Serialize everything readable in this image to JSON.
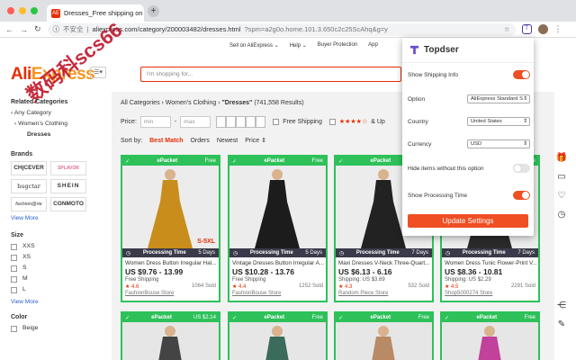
{
  "browser": {
    "tab_title": "Dresses_Free shipping on Dres",
    "tab_favicon": "AE",
    "new_tab": "+",
    "nav": {
      "back": "←",
      "forward": "→",
      "reload": "↻"
    },
    "security": "不安全",
    "url_main": "aliexpress.com/category/200003482/dresses.html",
    "url_query": "?spm=a2g0o.home.101.3.650c2c25ScAhq&g=y"
  },
  "topnav": [
    "Sell on AliExpress ⌄",
    "Help ⌄",
    "Buyer Protection",
    "App"
  ],
  "logo": {
    "ali": "Ali",
    "express": "Express"
  },
  "watermark": "数码科scs66",
  "search_placeholder": "I'm shopping for...",
  "sidebar": {
    "related_title": "Related Categories",
    "categories": [
      "‹  Any Category",
      "‹  Women's Clothing",
      "Dresses"
    ],
    "brands_title": "Brands",
    "brands": [
      "CH|CEVER",
      "SPLAVOR",
      "hugctar",
      "SHEIN",
      "fashion@rie",
      "CONMOTO"
    ],
    "view_more": "View More",
    "size_title": "Size",
    "sizes": [
      "XXS",
      "XS",
      "S",
      "M",
      "L"
    ],
    "view_more2": "View More",
    "color_title": "Color",
    "colors": [
      "Beige"
    ]
  },
  "breadcrumb": {
    "path": "All Categories  ›  Women's Clothing  ›  ",
    "current": "\"Dresses\"",
    "count": " (741,558 Results)"
  },
  "filters": {
    "price_label": "Price:",
    "min": "min",
    "dash": "-",
    "max": "max",
    "free_shipping": "Free Shipping",
    "stars": "★★★★☆",
    "and_up": "& Up"
  },
  "sort": {
    "label": "Sort by:",
    "options": [
      "Best Match",
      "Orders",
      "Newest",
      "Price ⇕"
    ]
  },
  "products": [
    {
      "shipping_badge": "ePacket",
      "tag": "Free",
      "processing_label": "Processing Time",
      "days": "5 Days",
      "title": "Women Dress Button Irregular Hal...",
      "price": "US $9.76 - 13.99",
      "shipping": "Free Shipping",
      "rating": "★ 4.6",
      "sold": "1064 Sold",
      "store": "FashionBouse Store",
      "size_tag": "S-5XL",
      "dress_color": "#c98d1c"
    },
    {
      "shipping_badge": "ePacket",
      "tag": "Free",
      "processing_label": "Processing Time",
      "days": "5 Days",
      "title": "Vintage Dresses Button Irregular A...",
      "price": "US $10.28 - 13.76",
      "shipping": "Free Shipping",
      "rating": "★ 4.4",
      "sold": "1252 Sold",
      "store": "FashionBouse Store",
      "size_tag": "",
      "dress_color": "#1c1c1c"
    },
    {
      "shipping_badge": "ePacket",
      "tag": "Free",
      "processing_label": "Processing Time",
      "days": "7 Days",
      "title": "Maxi Dresses V-Neck Three-Quart...",
      "price": "US $6.13 - 6.16",
      "shipping": "Shipping: US $3.69",
      "rating": "★ 4.3",
      "sold": "532 Sold",
      "store": "Random Piece Store",
      "size_tag": "",
      "dress_color": "#222222"
    },
    {
      "shipping_badge": "ePacket",
      "tag": "Free",
      "processing_label": "Processing Time",
      "days": "7 Days",
      "title": "Women Dress Tunic Flower-Print V...",
      "price": "US $8.36 - 10.81",
      "shipping": "Shipping: US $2.29",
      "rating": "★ 4.5",
      "sold": "2291 Sold",
      "store": "Shop5000274 Store",
      "size_tag": "",
      "dress_color": "#2a2a2a"
    }
  ],
  "products_row2": [
    {
      "shipping_badge": "ePacket",
      "tag": "US $2.14",
      "dress_color": "#444444"
    },
    {
      "shipping_badge": "ePacket",
      "tag": "Free",
      "dress_color": "#3b6b5a"
    },
    {
      "shipping_badge": "ePacket",
      "tag": "Free",
      "dress_color": "#b88a66"
    },
    {
      "shipping_badge": "ePacket",
      "tag": "Free",
      "dress_color": "#c2419a"
    }
  ],
  "popup": {
    "title": "Topdser",
    "show_shipping_info": "Show Shipping Info",
    "option_label": "Option",
    "option_value": "AliExpress Standard S",
    "country_label": "Country",
    "country_value": "United States",
    "currency_label": "Currency",
    "currency_value": "USD",
    "hide_items": "Hide items without this option",
    "show_processing": "Show Processing Time",
    "button": "Update Settings"
  },
  "colors": {
    "accent": "#e62e04",
    "green": "#2ec15a",
    "toggle_on": "#f04e23",
    "popup_button": "#f04e23"
  }
}
